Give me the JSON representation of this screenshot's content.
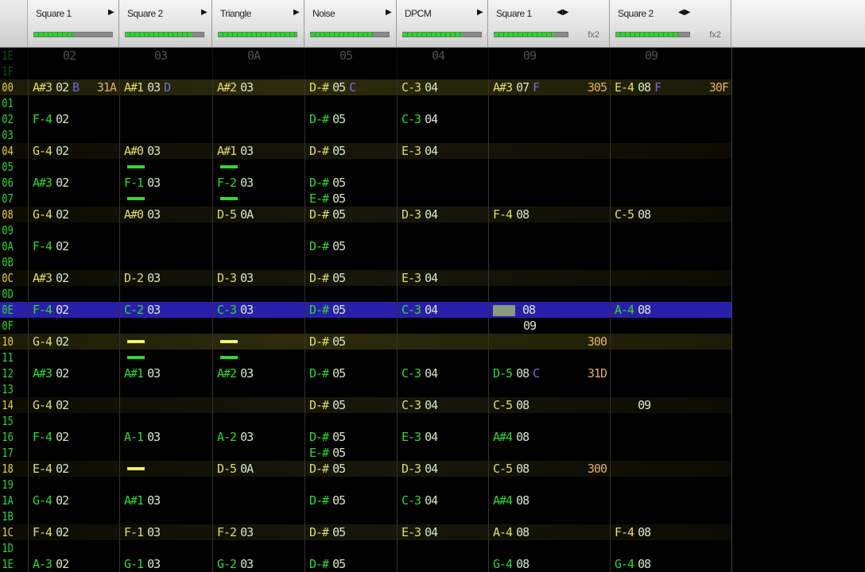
{
  "channels": [
    {
      "name": "Square 1",
      "meter": 0.5,
      "arrows": "▶"
    },
    {
      "name": "Square 2",
      "meter": 0.85,
      "arrows": "▶"
    },
    {
      "name": "Triangle",
      "meter": 1.0,
      "arrows": "▶"
    },
    {
      "name": "Noise",
      "meter": 0.8,
      "arrows": "▶"
    },
    {
      "name": "DPCM",
      "meter": 0.75,
      "arrows": "▶"
    },
    {
      "name": "Square 1",
      "meter": 0.8,
      "arrows": "◀▶",
      "fx": "fx2"
    },
    {
      "name": "Square 2",
      "meter": 0.85,
      "arrows": "◀▶",
      "fx": "fx2"
    }
  ],
  "colors": {
    "cursor_row": "#2a20a8",
    "note_green": "#33d633",
    "note_yellow": "#e2dc6a"
  },
  "rows": [
    {
      "label": "1E",
      "prev": true,
      "cells": [
        [
          "",
          "02",
          "",
          ""
        ],
        [
          "",
          "03",
          "",
          ""
        ],
        [
          "",
          "0A",
          "",
          ""
        ],
        [
          "",
          "05",
          "",
          ""
        ],
        [
          "",
          "04",
          "",
          ""
        ],
        [
          "",
          "09",
          "",
          ""
        ],
        [
          "",
          "09",
          "",
          ""
        ]
      ]
    },
    {
      "label": "1F",
      "prev": true,
      "cells": [
        [
          "",
          "",
          "",
          ""
        ],
        [
          "",
          "",
          "",
          ""
        ],
        [
          "",
          "",
          "",
          ""
        ],
        [
          "",
          "",
          "",
          ""
        ],
        [
          "",
          "",
          "",
          ""
        ],
        [
          "",
          "",
          "",
          ""
        ],
        [
          "",
          "",
          "",
          ""
        ]
      ]
    },
    {
      "label": "00",
      "cells": [
        [
          "A#3",
          "02",
          "B",
          "31A"
        ],
        [
          "A#1",
          "03",
          "D",
          ""
        ],
        [
          "A#2",
          "03",
          "",
          ""
        ],
        [
          "D-#",
          "05",
          "C",
          ""
        ],
        [
          "C-3",
          "04",
          "",
          ""
        ],
        [
          "A#3",
          "07",
          "F",
          "305"
        ],
        [
          "E-4",
          "08",
          "F",
          "30F"
        ]
      ]
    },
    {
      "label": "01",
      "cells": []
    },
    {
      "label": "02",
      "cells": [
        [
          "F-4",
          "02",
          "",
          ""
        ],
        [
          "",
          "",
          "",
          ""
        ],
        [
          "",
          "",
          "",
          ""
        ],
        [
          "D-#",
          "05",
          "",
          ""
        ],
        [
          "C-3",
          "04",
          "",
          ""
        ]
      ]
    },
    {
      "label": "03",
      "cells": []
    },
    {
      "label": "04",
      "cells": [
        [
          "G-4",
          "02",
          "",
          ""
        ],
        [
          "A#0",
          "03",
          "",
          ""
        ],
        [
          "A#1",
          "03",
          "",
          ""
        ],
        [
          "D-#",
          "05",
          "",
          ""
        ],
        [
          "E-3",
          "04",
          "",
          ""
        ]
      ]
    },
    {
      "label": "05",
      "cells": [
        [
          "",
          "",
          "",
          ""
        ],
        [
          "===",
          "",
          "",
          ""
        ],
        [
          "===",
          "",
          "",
          ""
        ]
      ]
    },
    {
      "label": "06",
      "cells": [
        [
          "A#3",
          "02",
          "",
          ""
        ],
        [
          "F-1",
          "03",
          "",
          ""
        ],
        [
          "F-2",
          "03",
          "",
          ""
        ],
        [
          "D-#",
          "05",
          "",
          ""
        ]
      ]
    },
    {
      "label": "07",
      "cells": [
        [
          "",
          "",
          "",
          ""
        ],
        [
          "===",
          "",
          "",
          ""
        ],
        [
          "===",
          "",
          "",
          ""
        ],
        [
          "E-#",
          "05",
          "",
          ""
        ]
      ]
    },
    {
      "label": "08",
      "cells": [
        [
          "G-4",
          "02",
          "",
          ""
        ],
        [
          "A#0",
          "03",
          "",
          ""
        ],
        [
          "D-5",
          "0A",
          "",
          ""
        ],
        [
          "D-#",
          "05",
          "",
          ""
        ],
        [
          "D-3",
          "04",
          "",
          ""
        ],
        [
          "F-4",
          "08",
          "",
          ""
        ],
        [
          "C-5",
          "08",
          "",
          ""
        ]
      ]
    },
    {
      "label": "09",
      "cells": []
    },
    {
      "label": "0A",
      "cells": [
        [
          "F-4",
          "02",
          "",
          ""
        ],
        [
          "",
          "",
          "",
          ""
        ],
        [
          "",
          "",
          "",
          ""
        ],
        [
          "D-#",
          "05",
          "",
          ""
        ]
      ]
    },
    {
      "label": "0B",
      "cells": []
    },
    {
      "label": "0C",
      "cells": [
        [
          "A#3",
          "02",
          "",
          ""
        ],
        [
          "D-2",
          "03",
          "",
          ""
        ],
        [
          "D-3",
          "03",
          "",
          ""
        ],
        [
          "D-#",
          "05",
          "",
          ""
        ],
        [
          "E-3",
          "04",
          "",
          ""
        ]
      ]
    },
    {
      "label": "0D",
      "cells": []
    },
    {
      "label": "0E",
      "cursor": true,
      "cells": [
        [
          "F-4",
          "02",
          "",
          ""
        ],
        [
          "C-2",
          "03",
          "",
          ""
        ],
        [
          "C-3",
          "03",
          "",
          ""
        ],
        [
          "D-#",
          "05",
          "",
          ""
        ],
        [
          "C-3",
          "04",
          "",
          ""
        ],
        [
          "[]",
          "08",
          "",
          ""
        ],
        [
          "A-4",
          "08",
          "",
          ""
        ]
      ]
    },
    {
      "label": "0F",
      "cells": [
        [
          "",
          "",
          "",
          ""
        ],
        [
          "",
          "",
          "",
          ""
        ],
        [
          "",
          "",
          "",
          ""
        ],
        [
          "",
          "",
          "",
          ""
        ],
        [
          "",
          "",
          "",
          ""
        ],
        [
          "",
          "09",
          "",
          ""
        ]
      ]
    },
    {
      "label": "10",
      "cells": [
        [
          "G-4",
          "02",
          "",
          ""
        ],
        [
          "===",
          "",
          "",
          ""
        ],
        [
          "===",
          "",
          "",
          ""
        ],
        [
          "D-#",
          "05",
          "",
          ""
        ],
        [
          "",
          "",
          "",
          ""
        ],
        [
          "",
          "",
          "",
          "300"
        ]
      ]
    },
    {
      "label": "11",
      "cells": [
        [
          "",
          "",
          "",
          ""
        ],
        [
          "===",
          "",
          "",
          ""
        ],
        [
          "===",
          "",
          "",
          ""
        ]
      ]
    },
    {
      "label": "12",
      "cells": [
        [
          "A#3",
          "02",
          "",
          ""
        ],
        [
          "A#1",
          "03",
          "",
          ""
        ],
        [
          "A#2",
          "03",
          "",
          ""
        ],
        [
          "D-#",
          "05",
          "",
          ""
        ],
        [
          "C-3",
          "04",
          "",
          ""
        ],
        [
          "D-5",
          "08",
          "C",
          "31D"
        ]
      ]
    },
    {
      "label": "13",
      "cells": []
    },
    {
      "label": "14",
      "cells": [
        [
          "G-4",
          "02",
          "",
          ""
        ],
        [
          "",
          "",
          "",
          ""
        ],
        [
          "",
          "",
          "",
          ""
        ],
        [
          "D-#",
          "05",
          "",
          ""
        ],
        [
          "C-3",
          "04",
          "",
          ""
        ],
        [
          "C-5",
          "08",
          "",
          ""
        ],
        [
          "   ",
          "09",
          "",
          ""
        ]
      ]
    },
    {
      "label": "15",
      "cells": []
    },
    {
      "label": "16",
      "cells": [
        [
          "F-4",
          "02",
          "",
          ""
        ],
        [
          "A-1",
          "03",
          "",
          ""
        ],
        [
          "A-2",
          "03",
          "",
          ""
        ],
        [
          "D-#",
          "05",
          "",
          ""
        ],
        [
          "E-3",
          "04",
          "",
          ""
        ],
        [
          "A#4",
          "08",
          "",
          ""
        ]
      ]
    },
    {
      "label": "17",
      "cells": [
        [
          "",
          "",
          "",
          ""
        ],
        [
          "",
          "",
          "",
          ""
        ],
        [
          "",
          "",
          "",
          ""
        ],
        [
          "E-#",
          "05",
          "",
          ""
        ]
      ]
    },
    {
      "label": "18",
      "cells": [
        [
          "E-4",
          "02",
          "",
          ""
        ],
        [
          "===",
          "",
          "",
          ""
        ],
        [
          "D-5",
          "0A",
          "",
          ""
        ],
        [
          "D-#",
          "05",
          "",
          ""
        ],
        [
          "D-3",
          "04",
          "",
          ""
        ],
        [
          "C-5",
          "08",
          "",
          "300"
        ]
      ]
    },
    {
      "label": "19",
      "cells": []
    },
    {
      "label": "1A",
      "cells": [
        [
          "G-4",
          "02",
          "",
          ""
        ],
        [
          "A#1",
          "03",
          "",
          ""
        ],
        [
          "",
          "",
          "",
          ""
        ],
        [
          "D-#",
          "05",
          "",
          ""
        ],
        [
          "C-3",
          "04",
          "",
          ""
        ],
        [
          "A#4",
          "08",
          "",
          ""
        ]
      ]
    },
    {
      "label": "1B",
      "cells": []
    },
    {
      "label": "1C",
      "cells": [
        [
          "F-4",
          "02",
          "",
          ""
        ],
        [
          "F-1",
          "03",
          "",
          ""
        ],
        [
          "F-2",
          "03",
          "",
          ""
        ],
        [
          "D-#",
          "05",
          "",
          ""
        ],
        [
          "E-3",
          "04",
          "",
          ""
        ],
        [
          "A-4",
          "08",
          "",
          ""
        ],
        [
          "F-4",
          "08",
          "",
          ""
        ]
      ]
    },
    {
      "label": "1D",
      "cells": []
    },
    {
      "label": "1E",
      "cells": [
        [
          "A-3",
          "02",
          "",
          ""
        ],
        [
          "G-1",
          "03",
          "",
          ""
        ],
        [
          "G-2",
          "03",
          "",
          ""
        ],
        [
          "D-#",
          "05",
          "",
          ""
        ],
        [
          "",
          "",
          "",
          ""
        ],
        [
          "G-4",
          "08",
          "",
          ""
        ],
        [
          "G-4",
          "08",
          "",
          ""
        ]
      ]
    }
  ]
}
